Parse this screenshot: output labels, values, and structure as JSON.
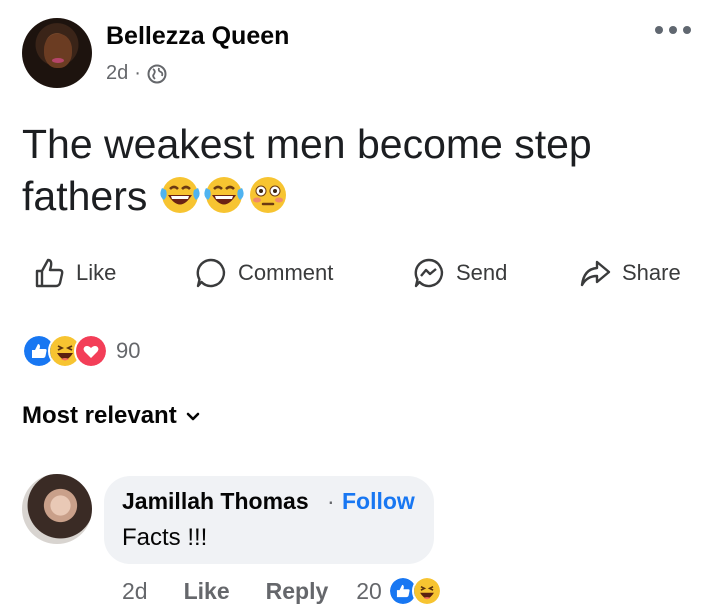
{
  "post": {
    "author": "Bellezza Queen",
    "time": "2d",
    "separator": "·",
    "privacy_icon": "globe-icon",
    "text": "The weakest men become step fathers",
    "emojis": [
      "face-with-tears-of-joy",
      "face-with-tears-of-joy",
      "flushed-face"
    ]
  },
  "actions": {
    "like": "Like",
    "comment": "Comment",
    "send": "Send",
    "share": "Share"
  },
  "reactions": {
    "types": [
      "like",
      "haha",
      "love"
    ],
    "count": "90"
  },
  "sort": {
    "label": "Most relevant"
  },
  "comment": {
    "author": "Jamillah Thomas",
    "separator": "·",
    "follow": "Follow",
    "text": "Facts !!!",
    "time": "2d",
    "like": "Like",
    "reply": "Reply",
    "reaction_count": "20",
    "reaction_types": [
      "like",
      "haha"
    ]
  },
  "colors": {
    "facebook_blue": "#1877f2",
    "secondary_text": "#65676b",
    "bubble_bg": "#f0f2f5"
  }
}
